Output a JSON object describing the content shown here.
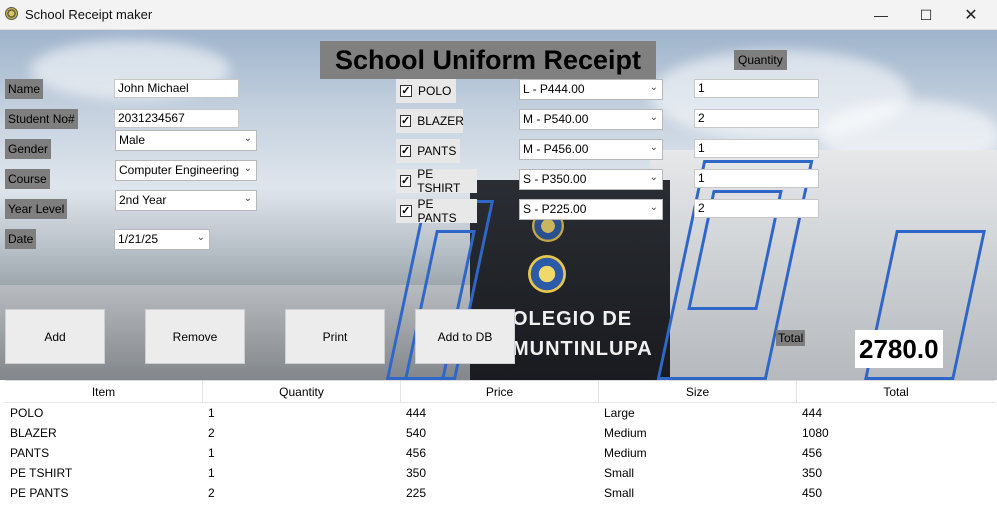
{
  "window": {
    "title": "School Receipt maker"
  },
  "header": {
    "title": "School Uniform Receipt",
    "quantity_label": "Quantity"
  },
  "form": {
    "name_label": "Name",
    "name_value": "John Michael",
    "student_no_label": "Student No#",
    "student_no_value": "2031234567",
    "gender_label": "Gender",
    "gender_value": "Male",
    "course_label": "Course",
    "course_value": "Computer Engineering",
    "year_label": "Year Level",
    "year_value": "2nd Year",
    "date_label": "Date",
    "date_value": "1/21/25"
  },
  "items": [
    {
      "label": "POLO",
      "checked": true,
      "size_price": "L - P444.00",
      "quantity": "1"
    },
    {
      "label": "BLAZER",
      "checked": true,
      "size_price": "M - P540.00",
      "quantity": "2"
    },
    {
      "label": "PANTS",
      "checked": true,
      "size_price": "M - P456.00",
      "quantity": "1"
    },
    {
      "label": "PE TSHIRT",
      "checked": true,
      "size_price": "S - P350.00",
      "quantity": "1"
    },
    {
      "label": "PE PANTS",
      "checked": true,
      "size_price": "S - P225.00",
      "quantity": "2"
    }
  ],
  "buttons": {
    "add": "Add",
    "remove": "Remove",
    "print": "Print",
    "add_db": "Add to DB"
  },
  "total": {
    "label": "Total",
    "value": "2780.0"
  },
  "background_sign": {
    "line1": "OLEGIO DE",
    "line2": "MUNTINLUPA"
  },
  "table": {
    "columns": [
      "Item",
      "Quantity",
      "Price",
      "Size",
      "Total"
    ],
    "rows": [
      [
        "POLO",
        "1",
        "444",
        "Large",
        "444"
      ],
      [
        "BLAZER",
        "2",
        "540",
        "Medium",
        "1080"
      ],
      [
        "PANTS",
        "1",
        "456",
        "Medium",
        "456"
      ],
      [
        "PE TSHIRT",
        "1",
        "350",
        "Small",
        "350"
      ],
      [
        "PE PANTS",
        "2",
        "225",
        "Small",
        "450"
      ]
    ]
  },
  "icons": {
    "minimize": "minimize-icon",
    "maximize": "maximize-icon",
    "close": "close-icon",
    "dropdown": "chevron-down-icon",
    "check": "checkmark-icon"
  }
}
